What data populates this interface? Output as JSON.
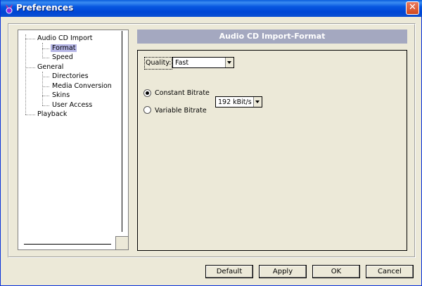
{
  "window": {
    "title": "Preferences",
    "close_glyph": "✕",
    "icon": "app-icon"
  },
  "tree": {
    "items": [
      {
        "label": "Audio CD Import",
        "level": 1
      },
      {
        "label": "Format",
        "level": 2,
        "selected": true
      },
      {
        "label": "Speed",
        "level": 2
      },
      {
        "label": "General",
        "level": 0
      },
      {
        "label": "Directories",
        "level": 2
      },
      {
        "label": "Media Conversion",
        "level": 2
      },
      {
        "label": "Skins",
        "level": 2
      },
      {
        "label": "User Access",
        "level": 2
      },
      {
        "label": "Playback",
        "level": 1
      }
    ]
  },
  "panel": {
    "header": "Audio CD Import-Format",
    "quality_label": "Quality:",
    "quality_value": "Fast",
    "bitrate_value": "192 kBit/s",
    "constant_bitrate": "Constant Bitrate",
    "variable_bitrate": "Variable Bitrate",
    "selected_mode": "constant"
  },
  "buttons": {
    "default": "Default",
    "apply": "Apply",
    "ok": "OK",
    "cancel": "Cancel"
  },
  "colors": {
    "titlebar": "#0054e3",
    "selection": "#b6b6e6",
    "header_bg": "#a4a8c0",
    "close_button": "#d24a1f"
  }
}
